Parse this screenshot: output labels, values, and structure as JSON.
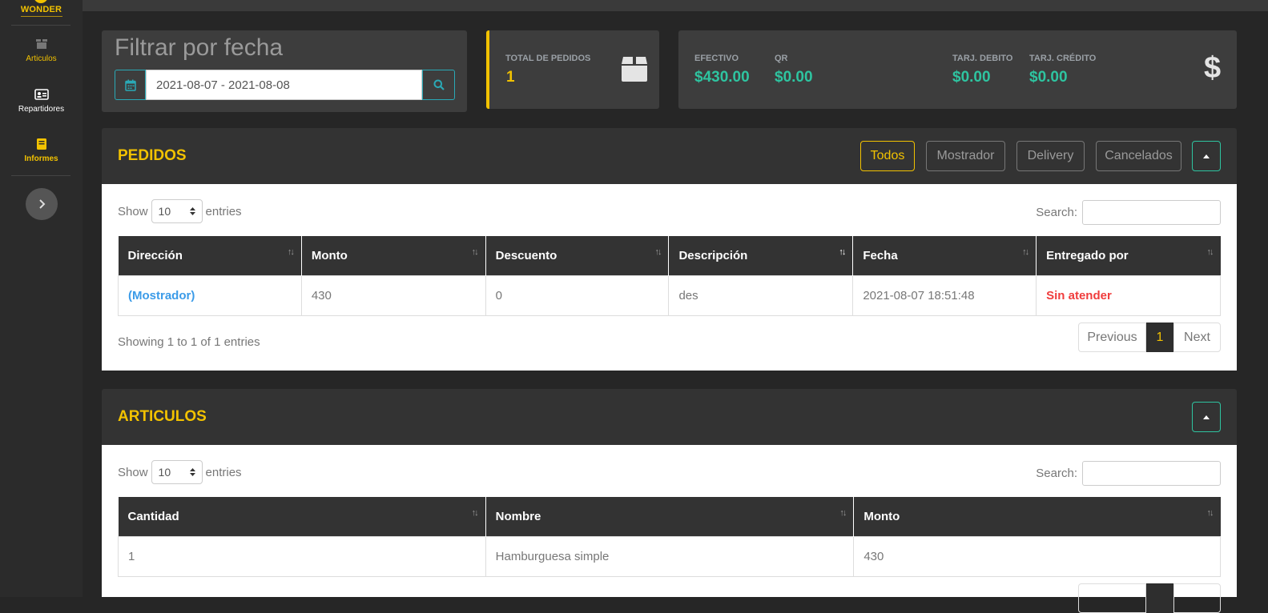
{
  "sidebar": {
    "logo_text": "WONDER",
    "items": [
      {
        "label": "Articulos",
        "icon": "box-icon",
        "color": "#f2c200"
      },
      {
        "label": "Repartidores",
        "icon": "id-card-icon",
        "color": "#ffffff"
      },
      {
        "label": "Informes",
        "icon": "book-icon",
        "color": "#f2c200"
      }
    ]
  },
  "filter": {
    "title": "Filtrar por fecha",
    "date_range": "2021-08-07 - 2021-08-08"
  },
  "totals": {
    "label": "TOTAL DE PEDIDOS",
    "value": "1"
  },
  "payments": [
    {
      "label": "EFECTIVO",
      "value": "$430.00"
    },
    {
      "label": "QR",
      "value": "$0.00"
    },
    {
      "label": "TARJ. DEBITO",
      "value": "$0.00"
    },
    {
      "label": "TARJ. CRÉDITO",
      "value": "$0.00"
    }
  ],
  "pedidos": {
    "title": "PEDIDOS",
    "filters": [
      "Todos",
      "Mostrador",
      "Delivery",
      "Cancelados"
    ],
    "active_filter": "Todos",
    "show_label": "Show",
    "entries_label": "entries",
    "page_size": "10",
    "search_label": "Search:",
    "columns": [
      "Dirección",
      "Monto",
      "Descuento",
      "Descripción",
      "Fecha",
      "Entregado por"
    ],
    "rows": [
      [
        "(Mostrador)",
        "430",
        "0",
        "des",
        "2021-08-07 18:51:48",
        "Sin atender"
      ]
    ],
    "info": "Showing 1 to 1 of 1 entries",
    "pager": {
      "prev": "Previous",
      "page": "1",
      "next": "Next"
    }
  },
  "articulos": {
    "title": "ARTICULOS",
    "show_label": "Show",
    "entries_label": "entries",
    "page_size": "10",
    "search_label": "Search:",
    "columns": [
      "Cantidad",
      "Nombre",
      "Monto"
    ],
    "rows": [
      [
        "1",
        "Hamburguesa simple",
        "430"
      ]
    ]
  },
  "colors": {
    "accent": "#f2c200",
    "money": "#2ec4a0",
    "link": "#3b9be8",
    "danger": "#f03c3c"
  }
}
